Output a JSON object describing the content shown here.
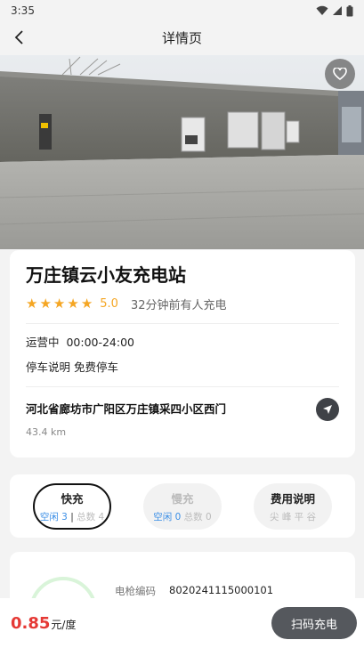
{
  "status_bar": {
    "time": "3:35"
  },
  "header": {
    "title": "详情页"
  },
  "station": {
    "name": "万庄镇云小友充电站",
    "rating": "5.0",
    "recent_activity": "32分钟前有人充电",
    "hours": "运营中  00:00-24:00",
    "parking": "停车说明 免费停车",
    "address": "河北省廊坊市广阳区万庄镇采四小区西门",
    "distance": "43.4 km"
  },
  "tabs": [
    {
      "label": "快充",
      "free": "空闲 3",
      "sep": "|",
      "total": "总数 4"
    },
    {
      "label": "慢充",
      "free": "空闲 0",
      "total": "总数 0"
    },
    {
      "label": "费用说明",
      "sub": "尖 峰 平 谷"
    }
  ],
  "gun": {
    "label": "电枪编码",
    "code": "8020241115000101"
  },
  "bottom": {
    "price": "0.85",
    "unit": "元/度",
    "scan_label": "扫码充电"
  }
}
